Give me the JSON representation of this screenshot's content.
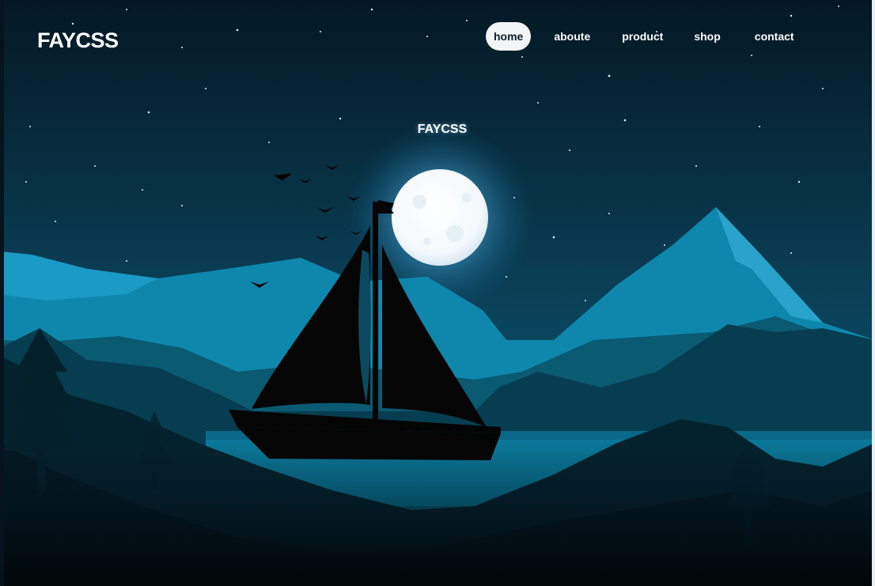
{
  "brand": {
    "logo": "FAYCSS"
  },
  "nav": {
    "items": [
      {
        "label": "home",
        "active": true
      },
      {
        "label": "aboute",
        "active": false
      },
      {
        "label": "product",
        "active": false
      },
      {
        "label": "shop",
        "active": false
      },
      {
        "label": "contact",
        "active": false
      }
    ]
  },
  "hero": {
    "title": "FAYCSS"
  },
  "colors": {
    "sky_top": "#05283a",
    "sky_bottom": "#0a6a86",
    "moon": "#ffffff",
    "nav_active_bg": "#f2f4f5",
    "silhouette": "#050505"
  }
}
